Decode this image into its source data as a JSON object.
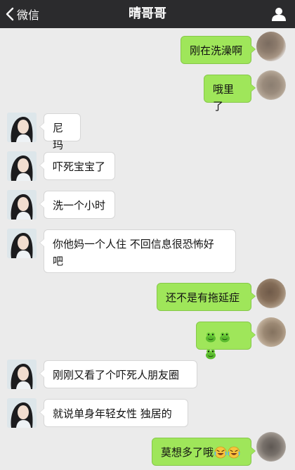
{
  "nav": {
    "back_label": "微信",
    "title": "晴哥哥"
  },
  "colors": {
    "nav_bg": "#2b2b2d",
    "chat_bg": "#ebebeb",
    "sent_bubble": "#9fe65a",
    "received_bubble": "#ffffff"
  },
  "messages": [
    {
      "side": "sent",
      "text": "刚在洗澡啊"
    },
    {
      "side": "sent",
      "text": "哦里了"
    },
    {
      "side": "received",
      "text": "尼玛"
    },
    {
      "side": "received",
      "text": "吓死宝宝了"
    },
    {
      "side": "received",
      "text": "洗一个小时"
    },
    {
      "side": "received",
      "line1": "你他妈一个人住 不回信息很恐怖好",
      "line2": "吧"
    },
    {
      "side": "sent",
      "text": "还不是有拖延症"
    },
    {
      "side": "sent",
      "emoji": [
        "frog-emoji",
        "frog-emoji",
        "frog-emoji"
      ]
    },
    {
      "side": "received",
      "text": "刚刚又看了个吓死人朋友圈"
    },
    {
      "side": "received",
      "text": "就说单身年轻女性 独居的"
    },
    {
      "side": "sent",
      "text": "莫想多了哦",
      "emoji": [
        "laugh-cry-emoji",
        "laugh-cry-emoji"
      ]
    }
  ]
}
